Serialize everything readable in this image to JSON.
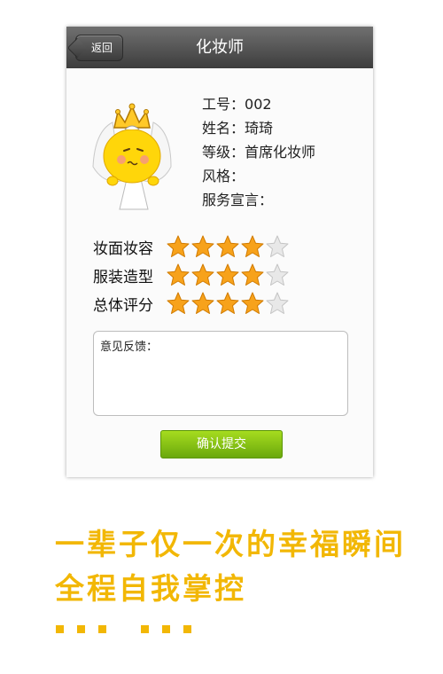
{
  "header": {
    "back_label": "返回",
    "title": "化妆师"
  },
  "profile": {
    "id_label": "工号：",
    "id_value": "002",
    "name_label": "姓名：",
    "name_value": "琦琦",
    "level_label": "等级：",
    "level_value": "首席化妆师",
    "style_label": "风格：",
    "style_value": "",
    "motto_label": "服务宣言：",
    "motto_value": ""
  },
  "ratings": [
    {
      "label": "妆面妆容",
      "stars": 4,
      "max": 5
    },
    {
      "label": "服装造型",
      "stars": 4,
      "max": 5
    },
    {
      "label": "总体评分",
      "stars": 4,
      "max": 5
    }
  ],
  "feedback": {
    "label": "意见反馈："
  },
  "submit_label": "确认提交",
  "slogan": {
    "line1": "一辈子仅一次的幸福瞬间",
    "line2": "全程自我掌控"
  },
  "colors": {
    "star_on": "#f7a21b",
    "star_off": "#e8e8e8",
    "accent": "#f2b705",
    "submit": "#8cc617"
  }
}
